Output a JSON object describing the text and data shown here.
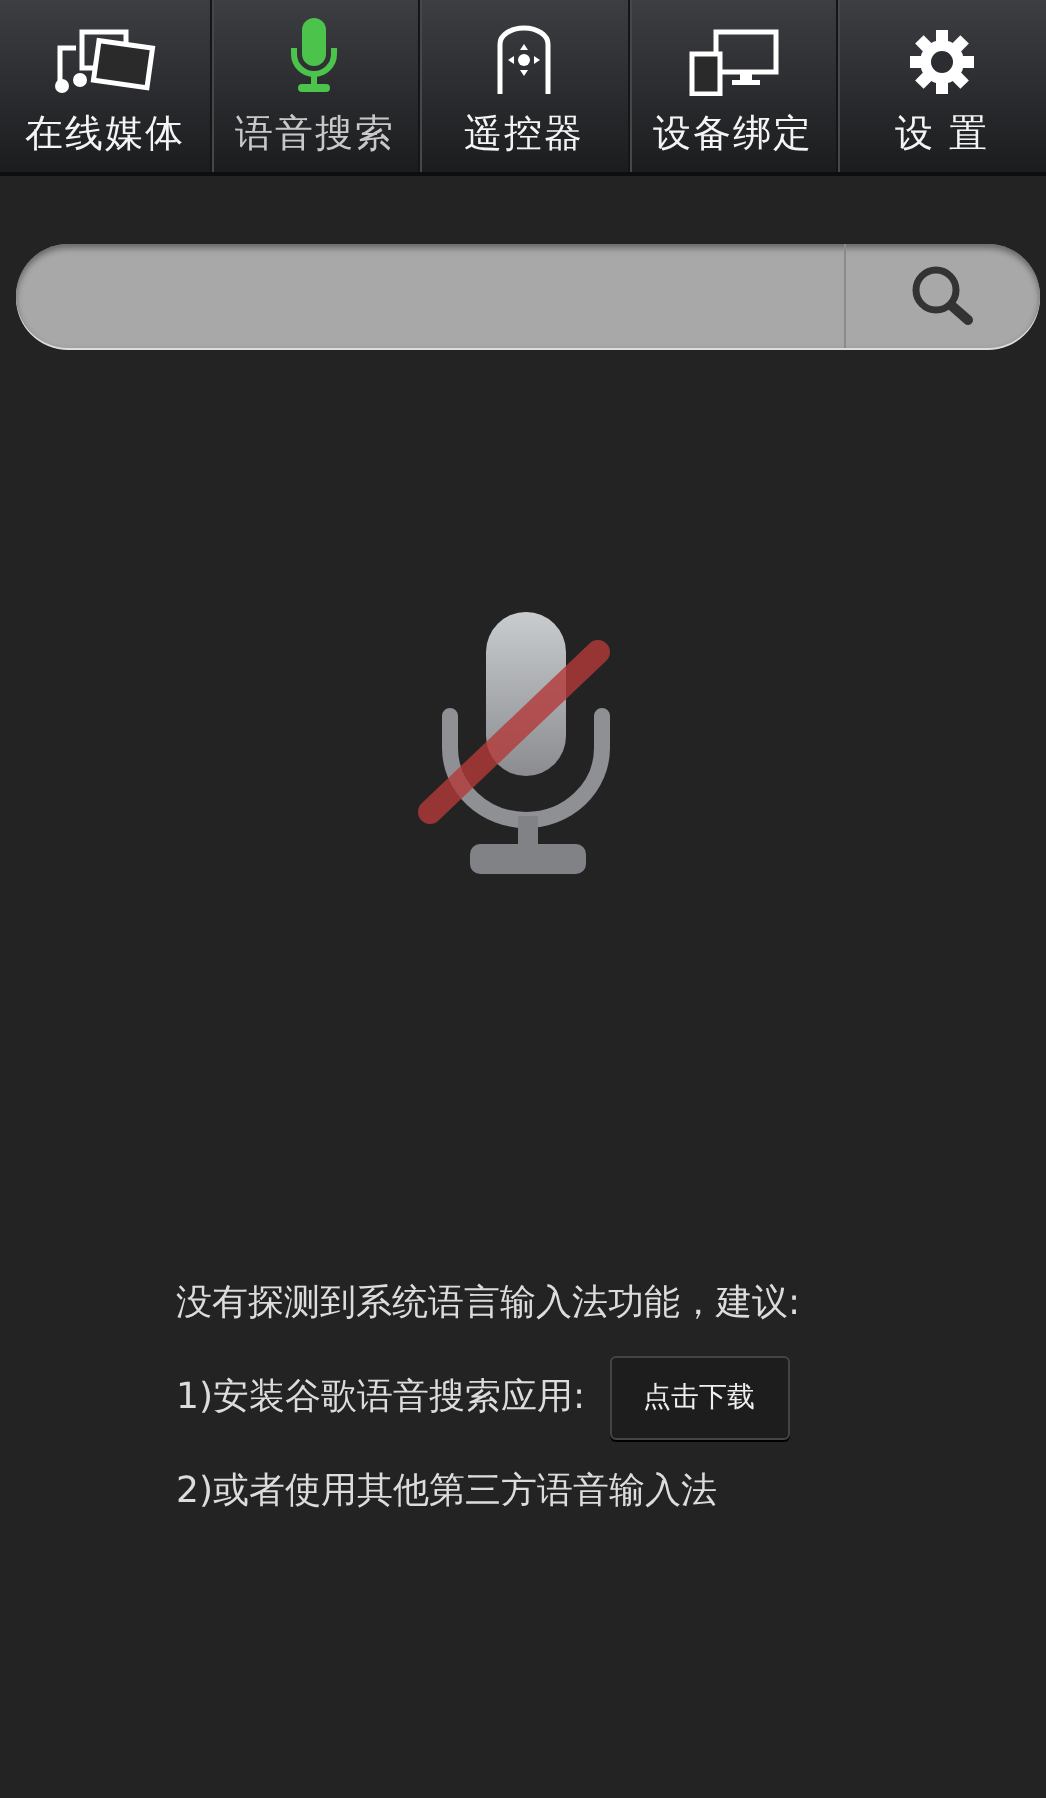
{
  "tabs": [
    {
      "label": "在线媒体",
      "kind": "media",
      "selected": false
    },
    {
      "label": "语音搜索",
      "kind": "mic",
      "selected": true
    },
    {
      "label": "遥控器",
      "kind": "remote",
      "selected": false
    },
    {
      "label": "设备绑定",
      "kind": "devices",
      "selected": false
    },
    {
      "label": "设 置",
      "kind": "settings",
      "selected": false
    }
  ],
  "voice": {
    "available": false
  },
  "message": {
    "heading": "没有探测到系统语言输入法功能，建议:",
    "option_1": "1)安装谷歌语音搜索应用:",
    "download_button": "点击下载",
    "option_2": "2)或者使用其他第三方语音输入法"
  }
}
